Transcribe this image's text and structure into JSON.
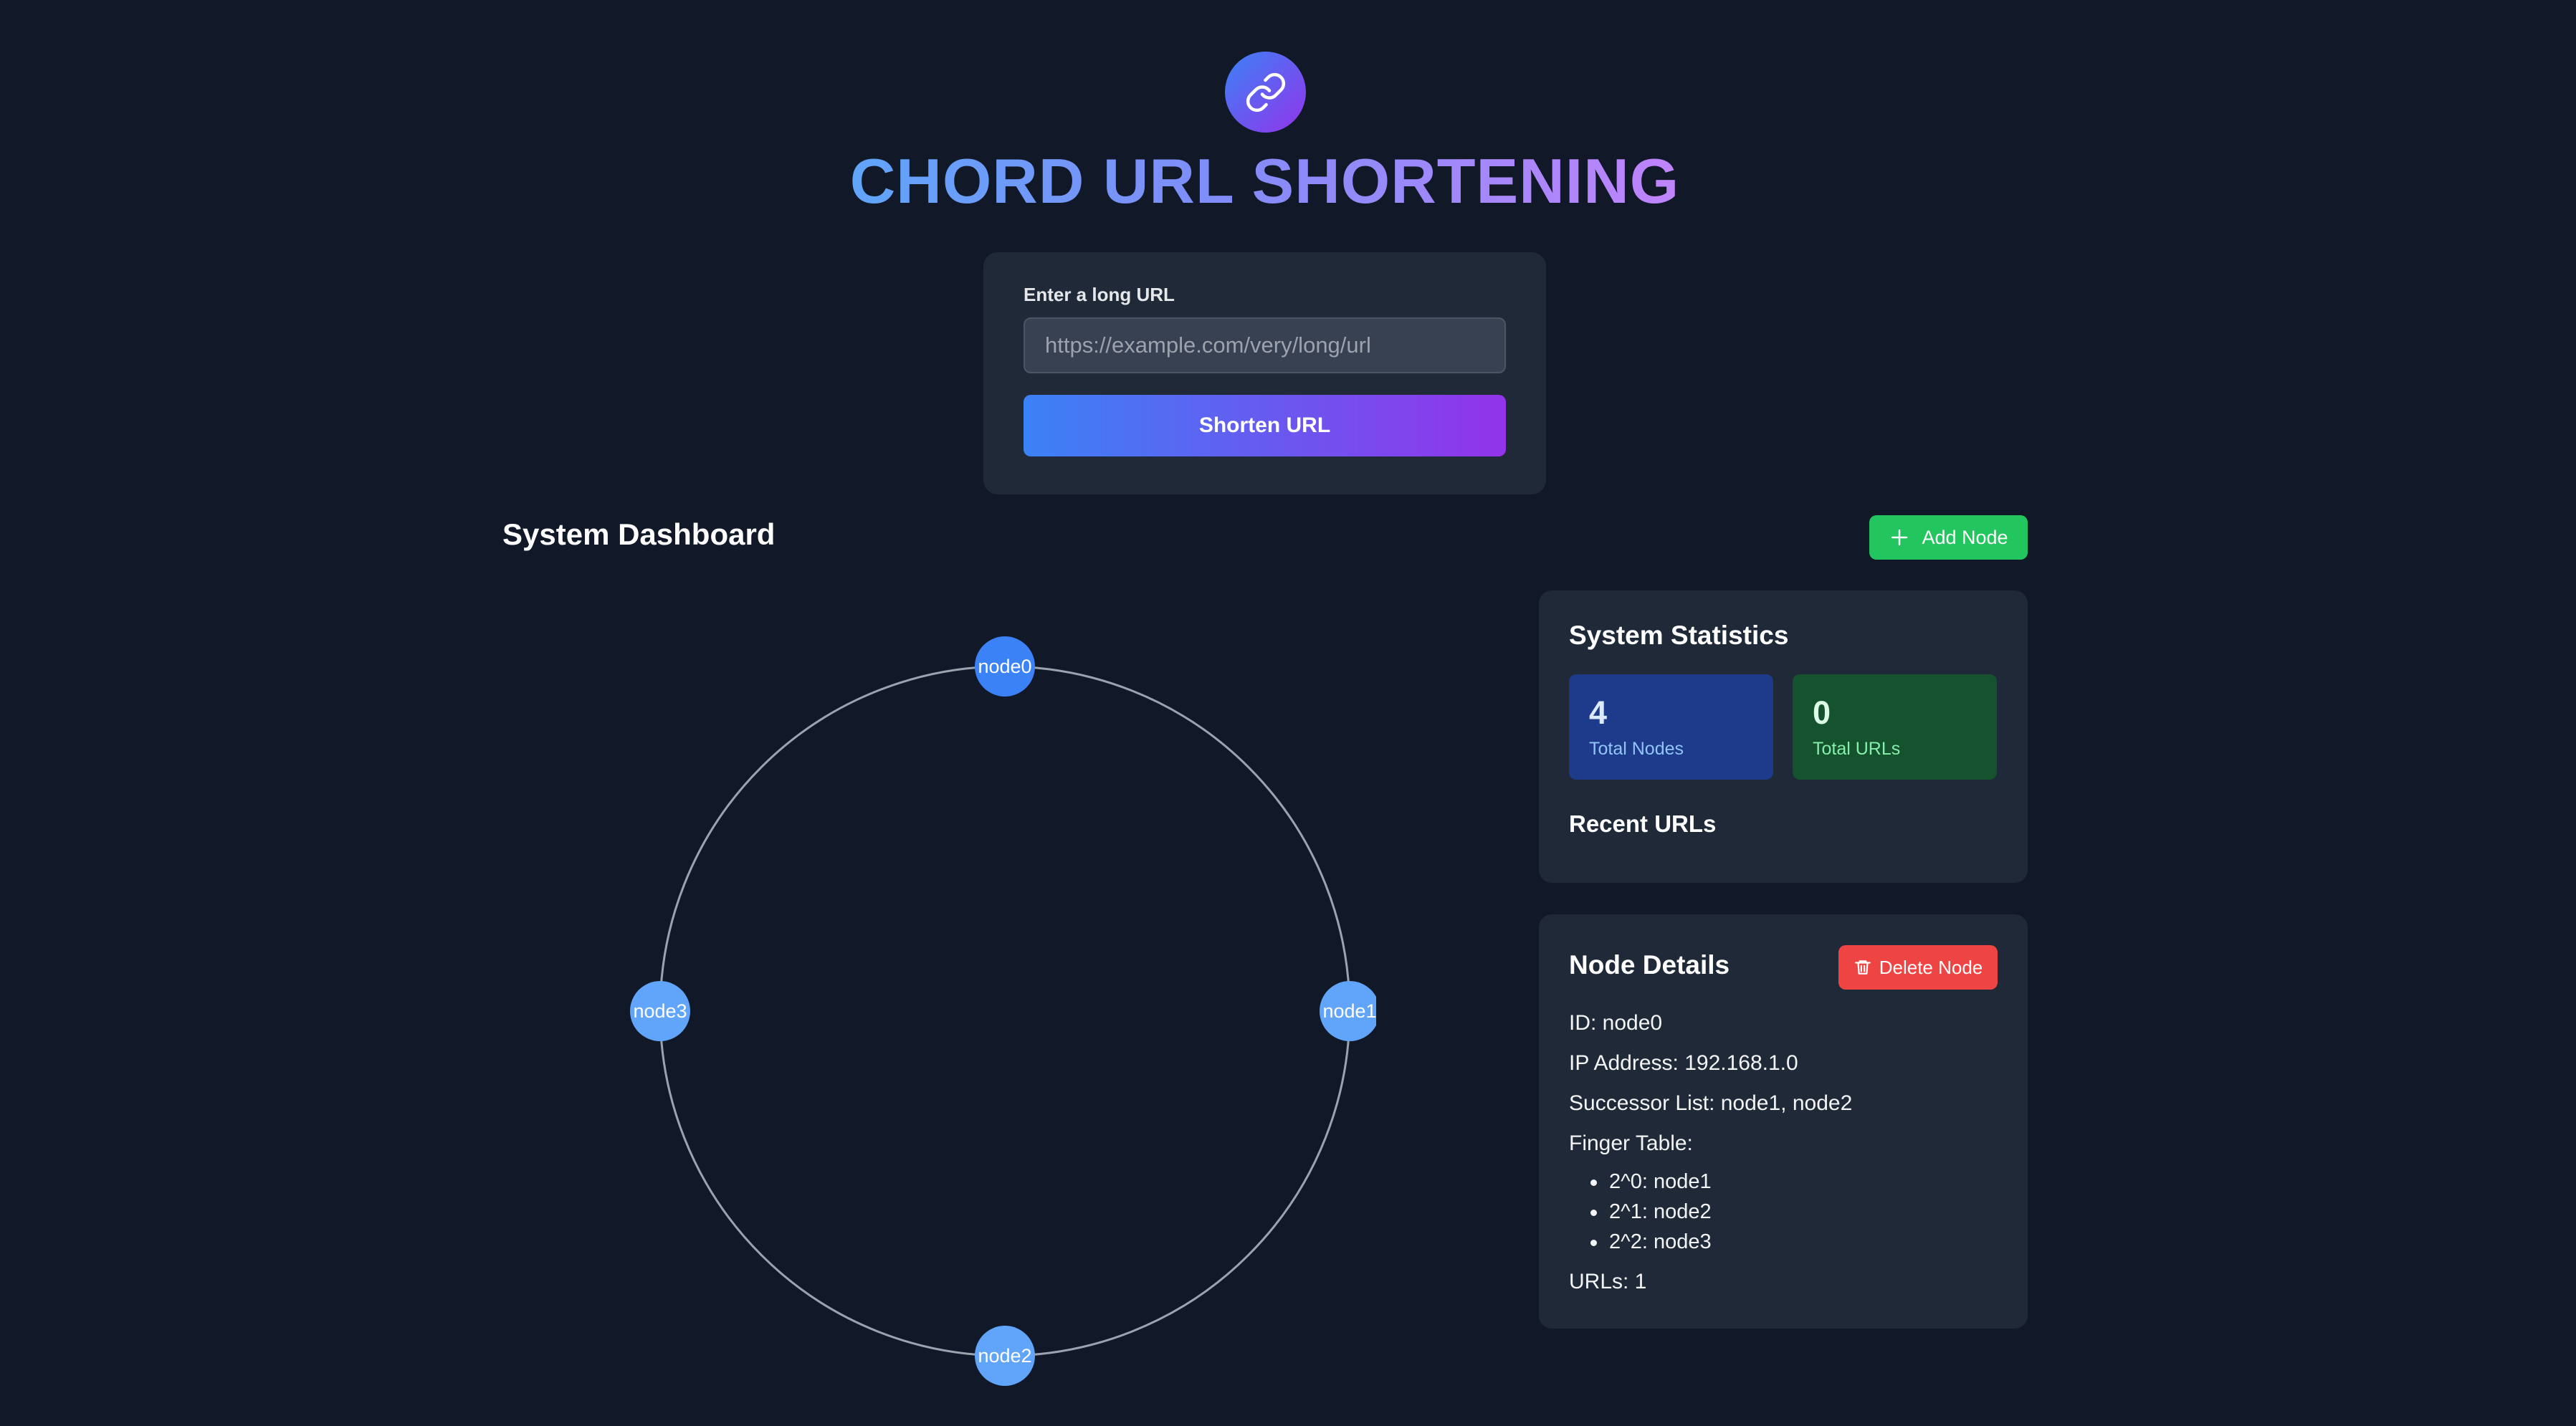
{
  "header": {
    "logo_icon": "link-icon",
    "title": "CHORD URL SHORTENING"
  },
  "url_form": {
    "label": "Enter a long URL",
    "input_value": "",
    "placeholder": "https://example.com/very/long/url",
    "submit_label": "Shorten URL"
  },
  "dashboard": {
    "title": "System Dashboard",
    "add_node_label": "Add Node",
    "add_node_icon": "plus-icon"
  },
  "ring": {
    "nodes": [
      "node0",
      "node1",
      "node2",
      "node3"
    ],
    "node_color": "#3b82f6",
    "ring_color": "#9ca3af"
  },
  "stats": {
    "title": "System Statistics",
    "total_nodes_value": "4",
    "total_nodes_label": "Total Nodes",
    "total_urls_value": "0",
    "total_urls_label": "Total URLs",
    "recent_urls_title": "Recent URLs"
  },
  "node_details": {
    "title": "Node Details",
    "delete_label": "Delete Node",
    "delete_icon": "trash-icon",
    "id_line": "ID: node0",
    "ip_line": "IP Address: 192.168.1.0",
    "successor_line": "Successor List: node1, node2",
    "finger_table_label": "Finger Table:",
    "finger_table": [
      "2^0: node1",
      "2^1: node2",
      "2^2: node3"
    ],
    "urls_line": "URLs: 1"
  },
  "colors": {
    "background": "#111827",
    "card": "#1f2937",
    "accent_blue": "#3b82f6",
    "accent_purple": "#9333ea",
    "success": "#22c55e",
    "danger": "#ef4444"
  }
}
